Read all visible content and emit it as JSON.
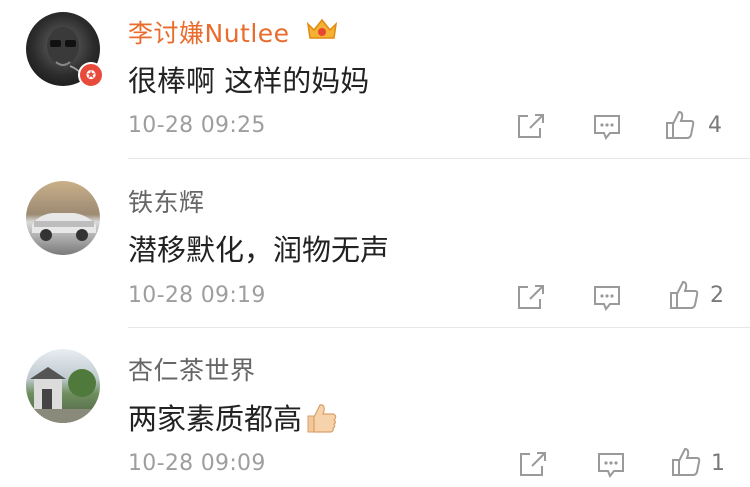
{
  "colors": {
    "vip_name": "#e96c2d",
    "name": "#666666",
    "text": "#222222",
    "meta": "#9e9e9e",
    "badge": "#e84b3c"
  },
  "comments": [
    {
      "username": "李讨嫌Nutlee",
      "text": "很棒啊 这样的妈妈",
      "time": "10-28 09:25",
      "likes": "4",
      "badge_icon": "crown-icon",
      "verified_icon": "star-badge"
    },
    {
      "username": "铁东辉",
      "text": "潜移默化，润物无声",
      "time": "10-28 09:19",
      "likes": "2"
    },
    {
      "username": "杏仁茶世界",
      "text": "两家素质都高",
      "time": "10-28 09:09",
      "likes": "1",
      "emoji_icon": "thumbs-up-emoji"
    }
  ]
}
